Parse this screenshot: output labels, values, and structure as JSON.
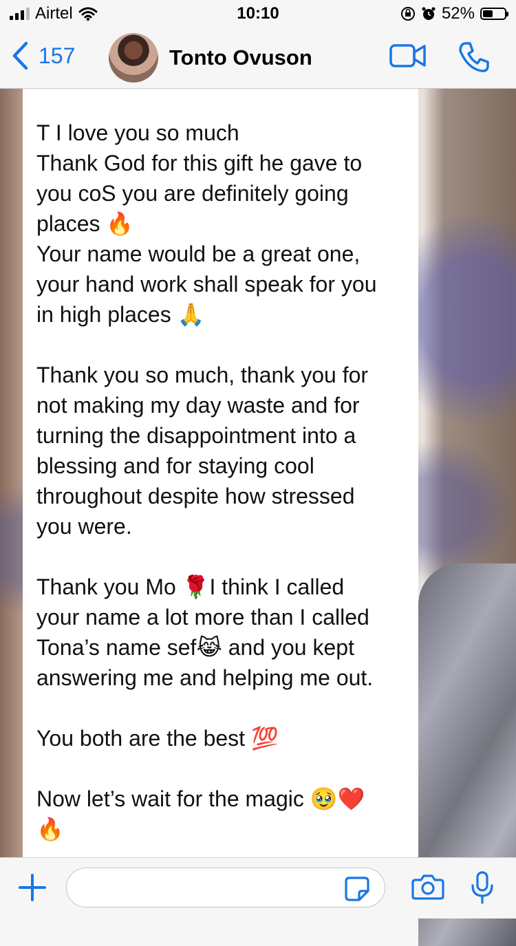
{
  "status_bar": {
    "carrier": "Airtel",
    "time": "10:10",
    "battery": "52%",
    "battery_level": 0.52
  },
  "header": {
    "back_count": "157",
    "contact_name": "Tonto Ovuson"
  },
  "message": {
    "lines": [
      "T I love you so much",
      "Thank God for this gift he gave to",
      "you coS you are definitely going",
      "places 🔥",
      "Your name would be a great one,",
      "your hand work shall speak for you",
      "in high places 🙏",
      "",
      "Thank you so much, thank you for",
      "not making my day waste and for",
      "turning the disappointment into a",
      "blessing and for staying cool",
      "throughout despite how stressed",
      "you were.",
      "",
      "Thank you Mo 🌹I think I called",
      "your name a lot more than I called",
      "Tona’s name sef😹 and you kept",
      "answering me and helping me out.",
      "",
      "You both are the best 💯",
      "",
      "Now let’s wait for the magic 🥹❤️",
      "🔥"
    ]
  },
  "composer": {
    "input_value": ""
  },
  "colors": {
    "accent": "#1877e5",
    "bubble": "#ffffff",
    "bar_background": "#f6f6f6"
  },
  "icons": [
    "signal-icon",
    "wifi-icon",
    "orientation-lock-icon",
    "alarm-icon",
    "battery-icon",
    "chevron-left-icon",
    "video-camera-icon",
    "phone-icon",
    "plus-icon",
    "sticker-icon",
    "camera-icon",
    "microphone-icon"
  ]
}
